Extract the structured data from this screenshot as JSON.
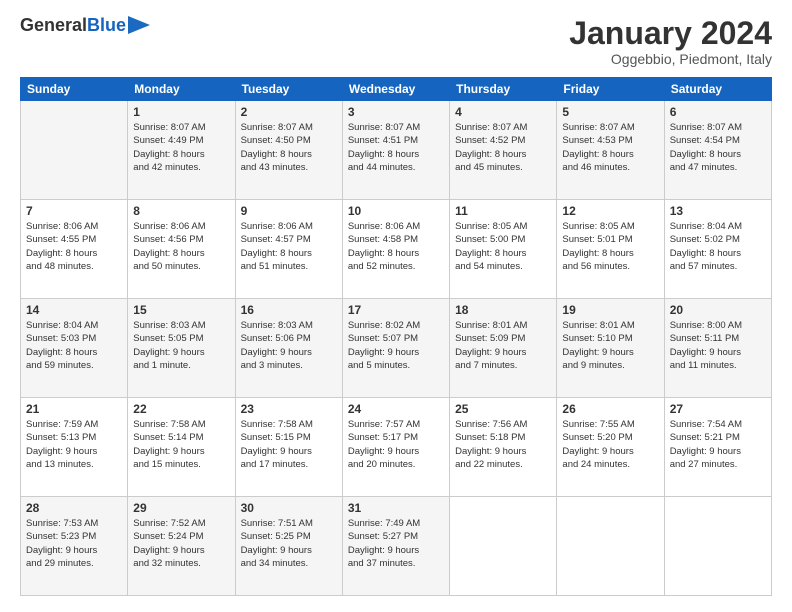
{
  "header": {
    "logo_general": "General",
    "logo_blue": "Blue",
    "month_title": "January 2024",
    "location": "Oggebbio, Piedmont, Italy"
  },
  "days_of_week": [
    "Sunday",
    "Monday",
    "Tuesday",
    "Wednesday",
    "Thursday",
    "Friday",
    "Saturday"
  ],
  "weeks": [
    [
      {
        "day": "",
        "info": ""
      },
      {
        "day": "1",
        "info": "Sunrise: 8:07 AM\nSunset: 4:49 PM\nDaylight: 8 hours\nand 42 minutes."
      },
      {
        "day": "2",
        "info": "Sunrise: 8:07 AM\nSunset: 4:50 PM\nDaylight: 8 hours\nand 43 minutes."
      },
      {
        "day": "3",
        "info": "Sunrise: 8:07 AM\nSunset: 4:51 PM\nDaylight: 8 hours\nand 44 minutes."
      },
      {
        "day": "4",
        "info": "Sunrise: 8:07 AM\nSunset: 4:52 PM\nDaylight: 8 hours\nand 45 minutes."
      },
      {
        "day": "5",
        "info": "Sunrise: 8:07 AM\nSunset: 4:53 PM\nDaylight: 8 hours\nand 46 minutes."
      },
      {
        "day": "6",
        "info": "Sunrise: 8:07 AM\nSunset: 4:54 PM\nDaylight: 8 hours\nand 47 minutes."
      }
    ],
    [
      {
        "day": "7",
        "info": ""
      },
      {
        "day": "8",
        "info": "Sunrise: 8:06 AM\nSunset: 4:56 PM\nDaylight: 8 hours\nand 50 minutes."
      },
      {
        "day": "9",
        "info": "Sunrise: 8:06 AM\nSunset: 4:57 PM\nDaylight: 8 hours\nand 51 minutes."
      },
      {
        "day": "10",
        "info": "Sunrise: 8:06 AM\nSunset: 4:58 PM\nDaylight: 8 hours\nand 52 minutes."
      },
      {
        "day": "11",
        "info": "Sunrise: 8:05 AM\nSunset: 5:00 PM\nDaylight: 8 hours\nand 54 minutes."
      },
      {
        "day": "12",
        "info": "Sunrise: 8:05 AM\nSunset: 5:01 PM\nDaylight: 8 hours\nand 56 minutes."
      },
      {
        "day": "13",
        "info": "Sunrise: 8:04 AM\nSunset: 5:02 PM\nDaylight: 8 hours\nand 57 minutes."
      }
    ],
    [
      {
        "day": "14",
        "info": ""
      },
      {
        "day": "15",
        "info": "Sunrise: 8:03 AM\nSunset: 5:05 PM\nDaylight: 9 hours\nand 1 minute."
      },
      {
        "day": "16",
        "info": "Sunrise: 8:03 AM\nSunset: 5:06 PM\nDaylight: 9 hours\nand 3 minutes."
      },
      {
        "day": "17",
        "info": "Sunrise: 8:02 AM\nSunset: 5:07 PM\nDaylight: 9 hours\nand 5 minutes."
      },
      {
        "day": "18",
        "info": "Sunrise: 8:01 AM\nSunset: 5:09 PM\nDaylight: 9 hours\nand 7 minutes."
      },
      {
        "day": "19",
        "info": "Sunrise: 8:01 AM\nSunset: 5:10 PM\nDaylight: 9 hours\nand 9 minutes."
      },
      {
        "day": "20",
        "info": "Sunrise: 8:00 AM\nSunset: 5:11 PM\nDaylight: 9 hours\nand 11 minutes."
      }
    ],
    [
      {
        "day": "21",
        "info": ""
      },
      {
        "day": "22",
        "info": "Sunrise: 7:58 AM\nSunset: 5:14 PM\nDaylight: 9 hours\nand 15 minutes."
      },
      {
        "day": "23",
        "info": "Sunrise: 7:58 AM\nSunset: 5:15 PM\nDaylight: 9 hours\nand 17 minutes."
      },
      {
        "day": "24",
        "info": "Sunrise: 7:57 AM\nSunset: 5:17 PM\nDaylight: 9 hours\nand 20 minutes."
      },
      {
        "day": "25",
        "info": "Sunrise: 7:56 AM\nSunset: 5:18 PM\nDaylight: 9 hours\nand 22 minutes."
      },
      {
        "day": "26",
        "info": "Sunrise: 7:55 AM\nSunset: 5:20 PM\nDaylight: 9 hours\nand 24 minutes."
      },
      {
        "day": "27",
        "info": "Sunrise: 7:54 AM\nSunset: 5:21 PM\nDaylight: 9 hours\nand 27 minutes."
      }
    ],
    [
      {
        "day": "28",
        "info": ""
      },
      {
        "day": "29",
        "info": "Sunrise: 7:52 AM\nSunset: 5:24 PM\nDaylight: 9 hours\nand 32 minutes."
      },
      {
        "day": "30",
        "info": "Sunrise: 7:51 AM\nSunset: 5:25 PM\nDaylight: 9 hours\nand 34 minutes."
      },
      {
        "day": "31",
        "info": "Sunrise: 7:49 AM\nSunset: 5:27 PM\nDaylight: 9 hours\nand 37 minutes."
      },
      {
        "day": "",
        "info": ""
      },
      {
        "day": "",
        "info": ""
      },
      {
        "day": "",
        "info": ""
      }
    ]
  ],
  "week0_sunday": "Sunrise: 8:06 AM\nSunset: 4:55 PM\nDaylight: 8 hours\nand 48 minutes.",
  "week2_sunday": "Sunrise: 8:04 AM\nSunset: 5:03 PM\nDaylight: 8 hours\nand 59 minutes.",
  "week3_sunday": "Sunrise: 7:59 AM\nSunset: 5:13 PM\nDaylight: 9 hours\nand 13 minutes.",
  "week4_sunday": "Sunrise: 7:53 AM\nSunset: 5:23 PM\nDaylight: 9 hours\nand 29 minutes."
}
